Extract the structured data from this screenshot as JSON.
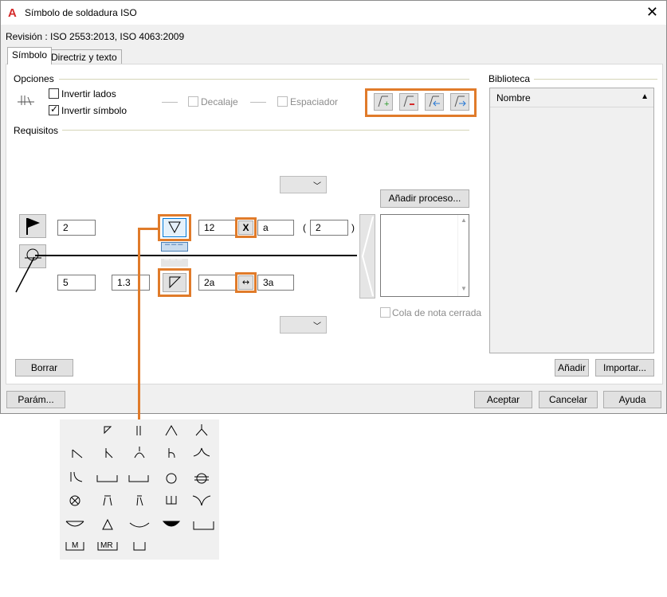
{
  "window": {
    "title": "Símbolo de soldadura ISO",
    "app_icon": "A"
  },
  "revision": "Revisión : ISO 2553:2013, ISO 4063:2009",
  "tabs": [
    "Símbolo",
    "Directriz y texto"
  ],
  "options": {
    "group_label": "Opciones",
    "invert_sides": "Invertir lados",
    "invert_symbol": "Invertir símbolo",
    "offset": "Decalaje",
    "spacer": "Espaciador"
  },
  "requirements": {
    "group_label": "Requisitos"
  },
  "fields": {
    "top_left": "2",
    "top_size": "12",
    "top_x_label": "X",
    "top_a": "a",
    "top_paren_open": "(",
    "top_paren_value": "2",
    "top_paren_close": ")",
    "bottom_left": "5",
    "bottom_mid": "1.3",
    "bottom_size": "2a",
    "bottom_right": "3a"
  },
  "add_process_button": "Añadir proceso...",
  "closed_tail": "Cola de nota cerrada",
  "clear_button": "Borrar",
  "library": {
    "label": "Biblioteca",
    "column": "Nombre",
    "add_button": "Añadir",
    "import_button": "Importar..."
  },
  "footer": {
    "params_button": "Parám...",
    "ok_button": "Aceptar",
    "cancel_button": "Cancelar",
    "help_button": "Ayuda"
  },
  "symbol_palette": {
    "mr_label": "MR",
    "m_label": "M"
  },
  "colors": {
    "accent": "#e07b2a",
    "app_icon": "#d52a2a"
  }
}
